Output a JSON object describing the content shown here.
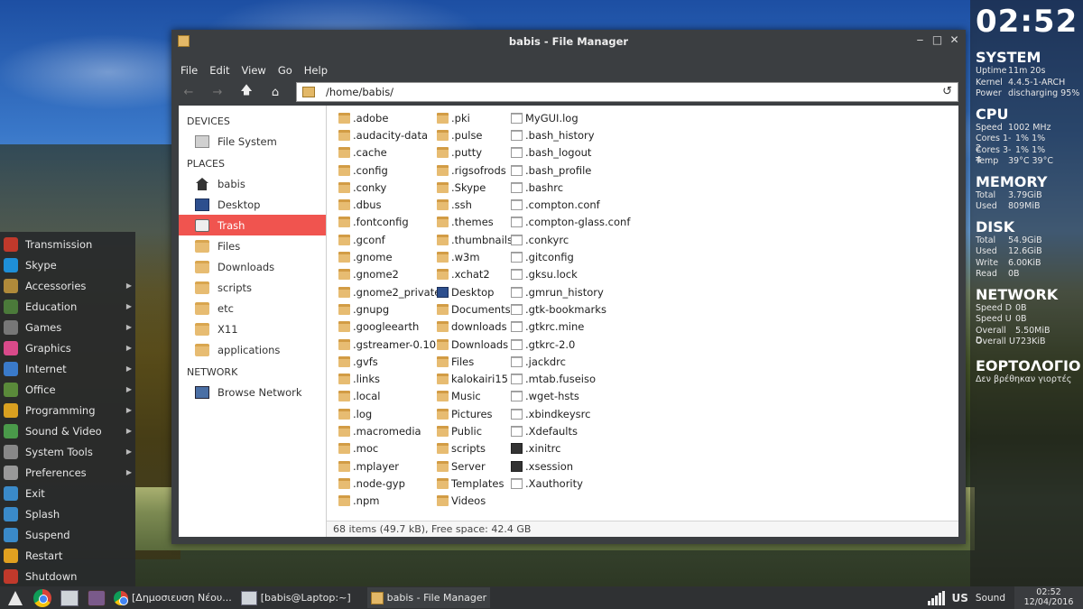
{
  "window": {
    "title": "babis - File Manager",
    "controls": [
      "‒",
      "□",
      "✕"
    ]
  },
  "menubar": [
    "File",
    "Edit",
    "View",
    "Go",
    "Help"
  ],
  "location": {
    "path": "/home/babis/"
  },
  "sidebar": {
    "devices_header": "DEVICES",
    "devices": [
      {
        "label": "File System",
        "icon": "drive-icon"
      }
    ],
    "places_header": "PLACES",
    "places": [
      {
        "label": "babis",
        "icon": "home-icon"
      },
      {
        "label": "Desktop",
        "icon": "desktop-icon"
      },
      {
        "label": "Trash",
        "icon": "trash-icon",
        "selected": true
      },
      {
        "label": "Files",
        "icon": "folder-icon"
      },
      {
        "label": "Downloads",
        "icon": "folder-icon"
      },
      {
        "label": "scripts",
        "icon": "folder-icon"
      },
      {
        "label": "etc",
        "icon": "folder-icon"
      },
      {
        "label": "X11",
        "icon": "folder-icon"
      },
      {
        "label": "applications",
        "icon": "folder-icon"
      }
    ],
    "network_header": "NETWORK",
    "network": [
      {
        "label": "Browse Network",
        "icon": "network-icon"
      }
    ]
  },
  "files": {
    "col1": [
      ".adobe",
      ".audacity-data",
      ".cache",
      ".config",
      ".conky",
      ".dbus",
      ".fontconfig",
      ".gconf",
      ".gnome",
      ".gnome2",
      ".gnome2_private",
      ".gnupg",
      ".googleearth",
      ".gstreamer-0.10",
      ".gvfs",
      ".links",
      ".local",
      ".log",
      ".macromedia",
      ".moc",
      ".mplayer",
      ".node-gyp",
      ".npm"
    ],
    "col2": [
      ".pki",
      ".pulse",
      ".putty",
      ".rigsofrods",
      ".Skype",
      ".ssh",
      ".themes",
      ".thumbnails",
      ".w3m",
      ".xchat2",
      "Desktop",
      "Documents",
      "downloads",
      "Downloads",
      "Files",
      "kalokairi15",
      "Music",
      "Pictures",
      "Public",
      "scripts",
      "Server",
      "Templates",
      "Videos"
    ],
    "col2_types": [
      "folder",
      "folder",
      "folder",
      "folder",
      "folder",
      "folder",
      "folder",
      "folder",
      "folder",
      "folder",
      "desktop",
      "folder",
      "folder",
      "folder",
      "folder",
      "folder",
      "folder",
      "folder",
      "folder",
      "folder",
      "folder",
      "folder",
      "folder"
    ],
    "col3": [
      "MyGUI.log",
      ".bash_history",
      ".bash_logout",
      ".bash_profile",
      ".bashrc",
      ".compton.conf",
      ".compton-glass.conf",
      ".conkyrc",
      ".gitconfig",
      ".gksu.lock",
      ".gmrun_history",
      ".gtk-bookmarks",
      ".gtkrc.mine",
      ".gtkrc-2.0",
      ".jackdrc",
      ".mtab.fuseiso",
      ".wget-hsts",
      ".xbindkeysrc",
      ".Xdefaults",
      ".xinitrc",
      ".xsession",
      ".Xauthority"
    ],
    "col3_types": [
      "file",
      "file",
      "file",
      "file",
      "file",
      "file",
      "file",
      "file",
      "file",
      "file",
      "file",
      "file",
      "file",
      "file",
      "file",
      "file",
      "file",
      "file",
      "file",
      "script",
      "script",
      "file"
    ]
  },
  "status": "68 items (49.7 kB), Free space: 42.4 GB",
  "start_menu": [
    {
      "label": "Transmission",
      "color": "#c0392b",
      "arrow": false
    },
    {
      "label": "Skype",
      "color": "#1e8fd8",
      "arrow": false
    },
    {
      "label": "Accessories",
      "color": "#b08a3a",
      "arrow": true
    },
    {
      "label": "Education",
      "color": "#4b7a3a",
      "arrow": true
    },
    {
      "label": "Games",
      "color": "#777777",
      "arrow": true
    },
    {
      "label": "Graphics",
      "color": "#d94a8a",
      "arrow": true
    },
    {
      "label": "Internet",
      "color": "#3a7ac9",
      "arrow": true
    },
    {
      "label": "Office",
      "color": "#5a8a3a",
      "arrow": true
    },
    {
      "label": "Programming",
      "color": "#d9a020",
      "arrow": true
    },
    {
      "label": "Sound & Video",
      "color": "#4a9a4a",
      "arrow": true
    },
    {
      "label": "System Tools",
      "color": "#888888",
      "arrow": true
    },
    {
      "label": "Preferences",
      "color": "#999999",
      "arrow": true
    },
    {
      "label": "Exit",
      "color": "#3a8ac9",
      "arrow": false
    },
    {
      "label": "Splash",
      "color": "#3a8ac9",
      "arrow": false
    },
    {
      "label": "Suspend",
      "color": "#3a8ac9",
      "arrow": false
    },
    {
      "label": "Restart",
      "color": "#e0a020",
      "arrow": false
    },
    {
      "label": "Shutdown",
      "color": "#c0392b",
      "arrow": false
    }
  ],
  "conky": {
    "clock": "02:52",
    "system": {
      "title": "SYSTEM",
      "uptime_k": "Uptime",
      "uptime_v": "11m 20s",
      "kernel_k": "Kernel",
      "kernel_v": "4.4.5-1-ARCH",
      "power_k": "Power",
      "power_v": "discharging 95%"
    },
    "cpu": {
      "title": "CPU",
      "speed_k": "Speed",
      "speed_v": "1002 MHz",
      "c12_k": "Cores 1-2",
      "c12_v": "1% 1%",
      "c34_k": "Cores 3-4",
      "c34_v": "1% 1%",
      "temp_k": "Temp",
      "temp_v": "39°C 39°C"
    },
    "memory": {
      "title": "MEMORY",
      "total_k": "Total",
      "total_v": "3.79GiB",
      "used_k": "Used",
      "used_v": "809MiB"
    },
    "disk": {
      "title": "DISK",
      "total_k": "Total",
      "total_v": "54.9GiB",
      "used_k": "Used",
      "used_v": "12.6GiB",
      "write_k": "Write",
      "write_v": "6.00KiB",
      "read_k": "Read",
      "read_v": "0B"
    },
    "network": {
      "title": "NETWORK",
      "sd_k": "Speed D",
      "sd_v": "0B",
      "su_k": "Speed U",
      "su_v": "0B",
      "od_k": "Overall D",
      "od_v": "5.50MiB",
      "ou_k": "Overall U",
      "ou_v": "723KiB"
    },
    "nameday": {
      "title": "ΕΟΡΤΟΛΟΓΙΟ",
      "text": "Δεν βρέθηκαν γιορτές"
    }
  },
  "taskbar": {
    "tasks": [
      "[Δημοσιευση Νέου...",
      "[babis@Laptop:~]",
      "babis - File Manager"
    ],
    "layout": "US",
    "sound": "Sound",
    "time": "02:52",
    "date": "12/04/2016"
  }
}
